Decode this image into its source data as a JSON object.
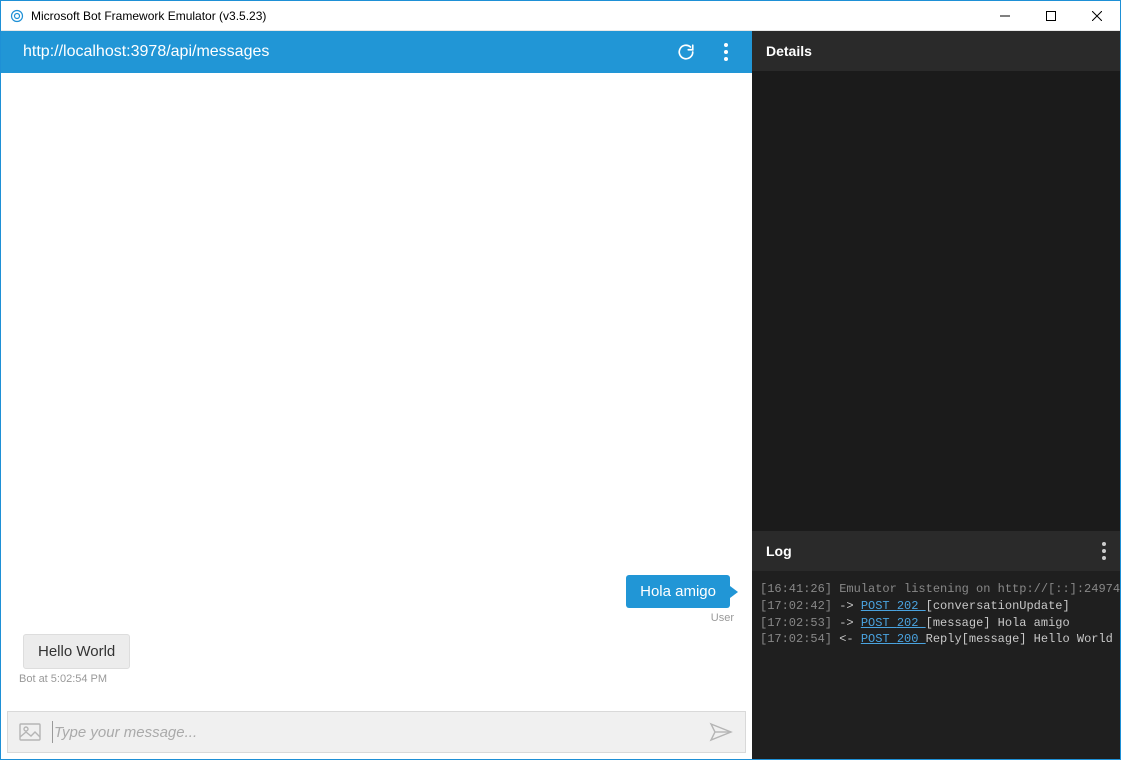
{
  "window": {
    "title": "Microsoft Bot Framework Emulator (v3.5.23)"
  },
  "address_bar": {
    "url": "http://localhost:3978/api/messages"
  },
  "messages": [
    {
      "from": "user",
      "text": "Hola amigo",
      "meta": "User"
    },
    {
      "from": "bot",
      "text": "Hello World",
      "meta": "Bot at 5:02:54 PM"
    }
  ],
  "input": {
    "placeholder": "Type your message..."
  },
  "panels": {
    "details_title": "Details",
    "log_title": "Log"
  },
  "log": [
    {
      "ts": "[16:41:26]",
      "dir": "",
      "method": "",
      "status": "",
      "text": "Emulator listening on http://[::]:24974",
      "dim": true
    },
    {
      "ts": "[17:02:42]",
      "dir": "->",
      "method": "POST",
      "status": "202",
      "text": "[conversationUpdate]"
    },
    {
      "ts": "[17:02:53]",
      "dir": "->",
      "method": "POST",
      "status": "202",
      "text": "[message] Hola amigo"
    },
    {
      "ts": "[17:02:54]",
      "dir": "<-",
      "method": "POST",
      "status": "200",
      "text": "Reply[message] Hello World"
    }
  ]
}
